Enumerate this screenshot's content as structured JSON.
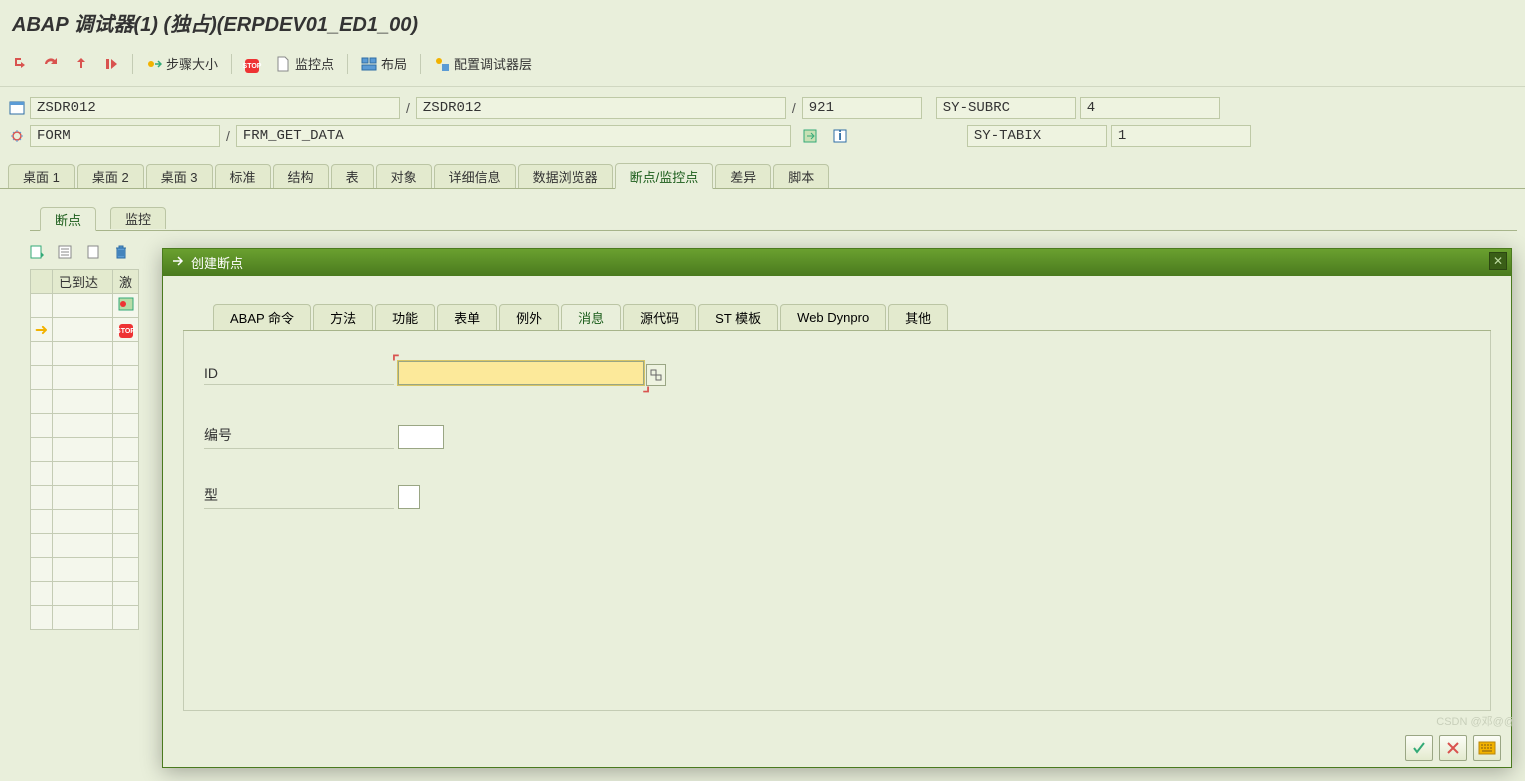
{
  "window": {
    "title": "ABAP 调试器(1)  (独占)(ERPDEV01_ED1_00)"
  },
  "toolbar": {
    "step_size": "步骤大小",
    "watchpoint": "监控点",
    "layout": "布局",
    "config_layer": "配置调试器层"
  },
  "program": {
    "main_program": "ZSDR012",
    "include": "ZSDR012",
    "line": "921",
    "event_type": "FORM",
    "event_name": "FRM_GET_DATA"
  },
  "sysvars": {
    "subrc_label": "SY-SUBRC",
    "subrc_value": "4",
    "tabix_label": "SY-TABIX",
    "tabix_value": "1"
  },
  "tabs": {
    "t1": "桌面 1",
    "t2": "桌面 2",
    "t3": "桌面 3",
    "std": "标准",
    "struct": "结构",
    "table": "表",
    "obj": "对象",
    "detail": "详细信息",
    "databrowse": "数据浏览器",
    "break": "断点/监控点",
    "diff": "差异",
    "script": "脚本"
  },
  "subtabs": {
    "bp": "断点",
    "wp": "监控"
  },
  "bp_table": {
    "col_reached": "已到达",
    "col_active": "激"
  },
  "modal": {
    "title": "创建断点",
    "tabs": {
      "abap": "ABAP 命令",
      "method": "方法",
      "func": "功能",
      "form": "表单",
      "exc": "例外",
      "msg": "消息",
      "src": "源代码",
      "st": "ST 模板",
      "wd": "Web Dynpro",
      "other": "其他"
    },
    "fields": {
      "id": "ID",
      "number": "编号",
      "type": "型"
    }
  },
  "watermark": "CSDN @邓@@"
}
